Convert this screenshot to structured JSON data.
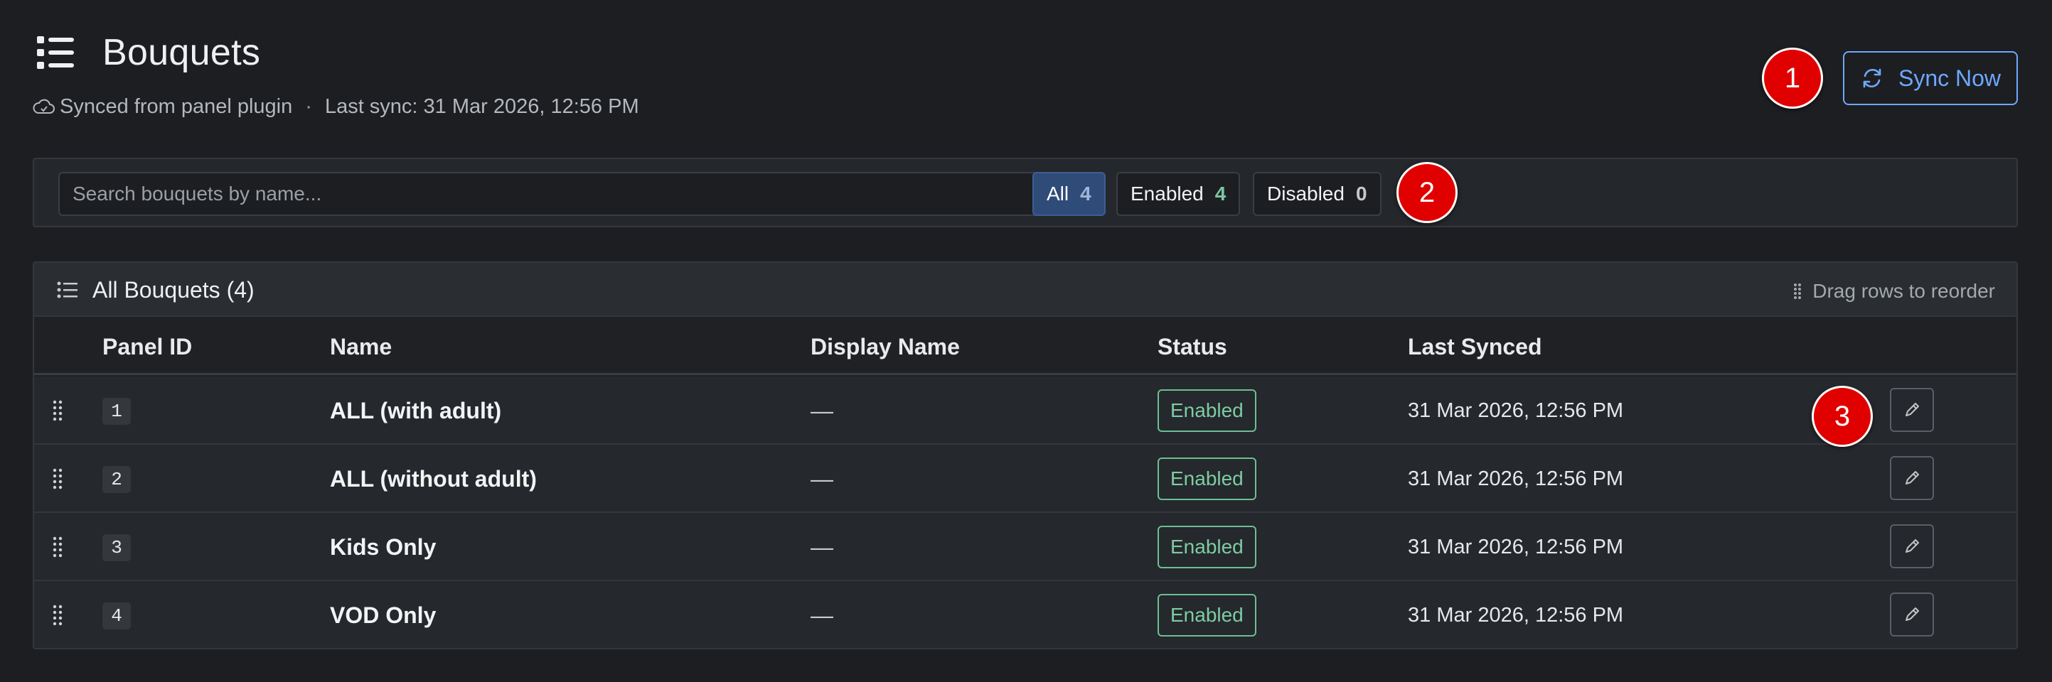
{
  "header": {
    "title": "Bouquets",
    "subtitle_source": "Synced from panel plugin",
    "subtitle_separator": "·",
    "subtitle_last_sync": "Last sync: 31 Mar 2026, 12:56 PM",
    "sync_button_label": "Sync Now"
  },
  "annotations": {
    "badge_1": "1",
    "badge_2": "2",
    "badge_3": "3"
  },
  "filters": {
    "search_placeholder": "Search bouquets by name...",
    "search_value": "",
    "chips": [
      {
        "label": "All",
        "count": "4",
        "selected": true
      },
      {
        "label": "Enabled",
        "count": "4",
        "selected": false
      },
      {
        "label": "Disabled",
        "count": "0",
        "selected": false
      }
    ]
  },
  "table": {
    "title": "All Bouquets (4)",
    "hint": "Drag rows to reorder",
    "columns": [
      "Panel ID",
      "Name",
      "Display Name",
      "Status",
      "Last Synced"
    ],
    "rows": [
      {
        "panel_id": "1",
        "name": "ALL (with adult)",
        "display_name": "—",
        "status": "Enabled",
        "last_synced": "31 Mar 2026, 12:56 PM"
      },
      {
        "panel_id": "2",
        "name": "ALL (without adult)",
        "display_name": "—",
        "status": "Enabled",
        "last_synced": "31 Mar 2026, 12:56 PM"
      },
      {
        "panel_id": "3",
        "name": "Kids Only",
        "display_name": "—",
        "status": "Enabled",
        "last_synced": "31 Mar 2026, 12:56 PM"
      },
      {
        "panel_id": "4",
        "name": "VOD Only",
        "display_name": "—",
        "status": "Enabled",
        "last_synced": "31 Mar 2026, 12:56 PM"
      }
    ]
  },
  "colors": {
    "background": "#1c1e21",
    "accent_blue": "#6ea8fe",
    "status_green": "#7dcca3",
    "annotation_red": "#e00000"
  },
  "icons": {
    "title_icon": "list-icon",
    "subtitle_icon": "cloud-icon",
    "sync_icon": "refresh-icon",
    "panel_icon": "list-icon",
    "drag_icon": "grip-vertical-icon",
    "edit_icon": "pencil-icon"
  }
}
